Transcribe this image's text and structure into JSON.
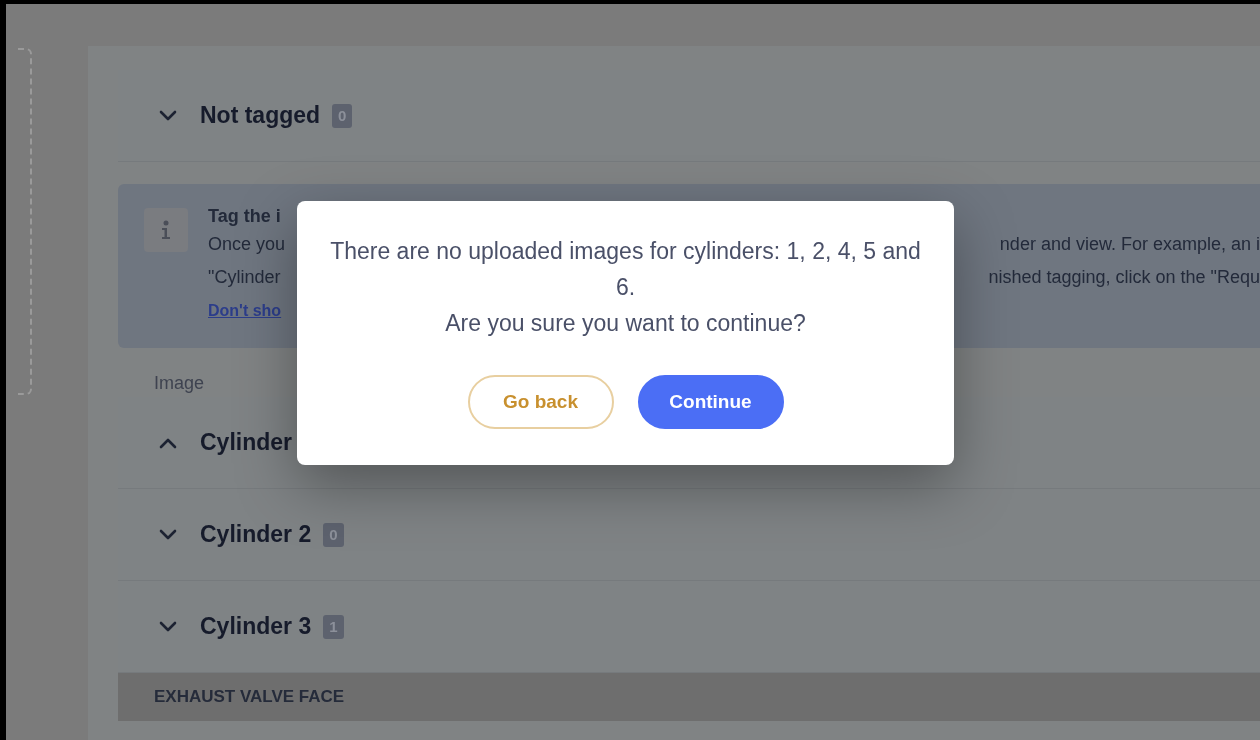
{
  "sections_top": [
    {
      "title": "Not tagged",
      "count": "0",
      "expanded": false
    }
  ],
  "info_banner": {
    "title": "Tag the i",
    "lines": [
      {
        "left": "Once you",
        "right": "nder and view. For example, an i"
      },
      {
        "left": "\"Cylinder",
        "right": "nished tagging, click on the \"Requ"
      }
    ],
    "link": "Don't sho"
  },
  "column_label": "Image",
  "cylinders": [
    {
      "title": "Cylinder",
      "expanded": true
    },
    {
      "title": "Cylinder 2",
      "count": "0",
      "expanded": false
    },
    {
      "title": "Cylinder 3",
      "count": "1",
      "expanded": false
    }
  ],
  "subheader": "EXHAUST VALVE FACE",
  "dialog": {
    "message_lines": [
      "There are no uploaded images for cylinders: 1, 2, 4, 5 and 6.",
      "Are you sure you want to continue?"
    ],
    "buttons": [
      {
        "label": "Go back",
        "kind": "secondary"
      },
      {
        "label": "Continue",
        "kind": "primary"
      }
    ]
  }
}
